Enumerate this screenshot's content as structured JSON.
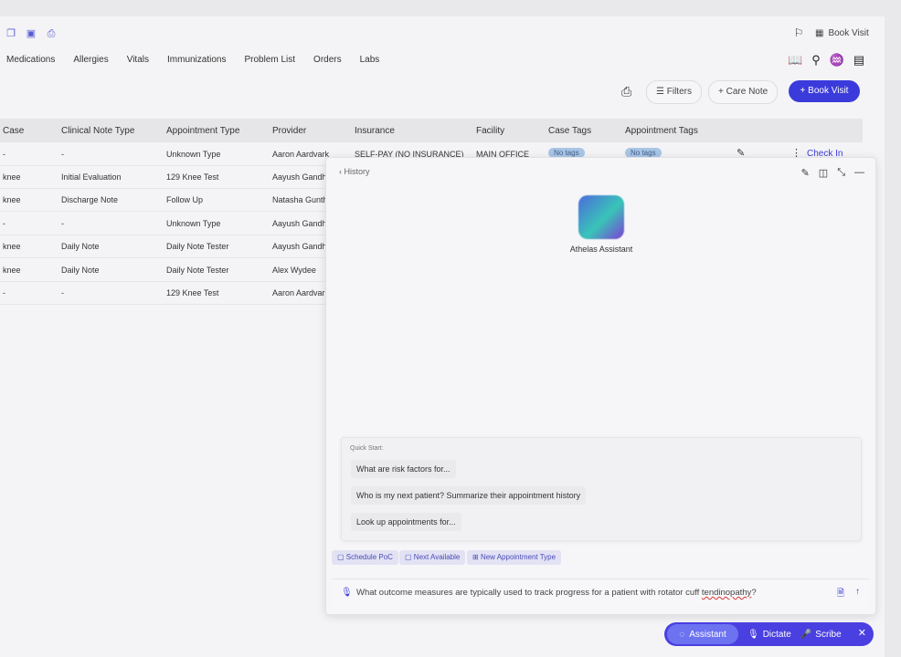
{
  "topbar": {
    "book_visit_label": "Book Visit"
  },
  "nav_tabs": [
    "Medications",
    "Allergies",
    "Vitals",
    "Immunizations",
    "Problem List",
    "Orders",
    "Labs"
  ],
  "toolbar": {
    "filters_label": "Filters",
    "care_note_label": "+ Care Note",
    "book_visit_label": "+ Book Visit"
  },
  "table": {
    "headers": [
      "Case",
      "Clinical Note Type",
      "Appointment Type",
      "Provider",
      "Insurance",
      "Facility",
      "Case Tags",
      "Appointment Tags"
    ],
    "rows": [
      [
        "-",
        "-",
        "Unknown Type",
        "Aaron Aardvark",
        "SELF-PAY (NO INSURANCE)",
        "MAIN OFFICE",
        "No tags",
        "No tags"
      ],
      [
        "knee",
        "Initial Evaluation",
        "129 Knee Test",
        "Aayush Gandh",
        "",
        "",
        "",
        ""
      ],
      [
        "knee",
        "Discharge Note",
        "Follow Up",
        "Natasha Gunth",
        "",
        "",
        "",
        ""
      ],
      [
        "-",
        "-",
        "Unknown Type",
        "Aayush Gandh",
        "",
        "",
        "",
        ""
      ],
      [
        "knee",
        "Daily Note",
        "Daily Note Tester",
        "Aayush Gandh",
        "",
        "",
        "",
        ""
      ],
      [
        "knee",
        "Daily Note",
        "Daily Note Tester",
        "Alex Wydee",
        "",
        "",
        "",
        ""
      ],
      [
        "-",
        "-",
        "129 Knee Test",
        "Aaron Aardvar",
        "",
        "",
        "",
        ""
      ]
    ],
    "check_in_label": "Check In"
  },
  "assistant": {
    "history_label": "History",
    "name": "Athelas Assistant",
    "quick_start_label": "Quick Start:",
    "quick_items": [
      "What are risk factors for...",
      "Who is my next patient? Summarize their appointment history",
      "Look up appointments for..."
    ],
    "chips": [
      "Schedule PoC",
      "Next Available",
      "New Appointment Type"
    ],
    "input_value_pre": "What outcome measures are typically used to track progress for a patient with rotator cuff ",
    "input_value_err": "tendinopathy",
    "input_value_post": "?"
  },
  "bottom_bar": {
    "assistant_label": "Assistant",
    "dictate_label": "Dictate",
    "scribe_label": "Scribe"
  }
}
